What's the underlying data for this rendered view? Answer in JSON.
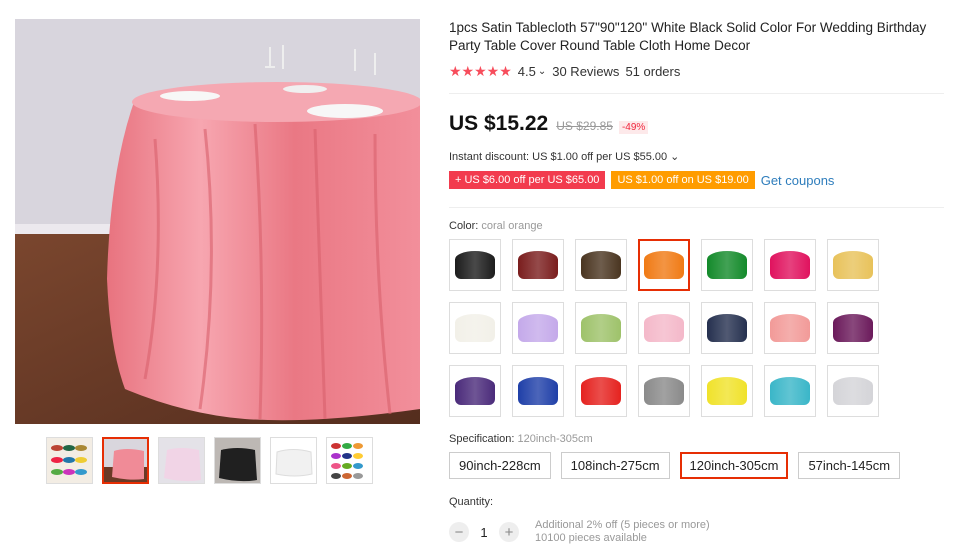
{
  "product": {
    "title": "1pcs Satin Tablecloth 57\"90\"120'' White Black Solid Color For Wedding Birthday Party Table Cover Round Table Cloth Home Decor",
    "stars": "★★★★★",
    "rating": "4.5",
    "rating_chevron": "⌄",
    "reviews": "30 Reviews",
    "orders": "51 orders"
  },
  "price": {
    "current": "US $15.22",
    "original": "US $29.85",
    "discount": "-49%"
  },
  "discount": {
    "instant": "Instant discount: US $1.00 off per US $55.00 ⌄",
    "coupon1": "+ US $6.00 off per US $65.00",
    "coupon2": "US $1.00 off on US $19.00",
    "get_coupons": "Get coupons"
  },
  "color": {
    "label": "Color: ",
    "value": "coral orange",
    "options": [
      "#1c1c1c",
      "#7a1d1d",
      "#4a3520",
      "#f07a14",
      "#138a2a",
      "#e0125e",
      "#e8c25a",
      "#f2f0e8",
      "#c4a9ea",
      "#9ec26a",
      "#f4b8c9",
      "#25304f",
      "#f29a98",
      "#6b1a5b",
      "#4a2a7a",
      "#1f3fa8",
      "#e5221f",
      "#8a8a8a",
      "#f0e22a",
      "#3ab6c8",
      "#d4d4d8"
    ],
    "selected_index": 3
  },
  "spec": {
    "label": "Specification: ",
    "value": "120inch-305cm",
    "options": [
      "90inch-228cm",
      "108inch-275cm",
      "120inch-305cm",
      "57inch-145cm"
    ],
    "selected_index": 2
  },
  "quantity": {
    "label": "Quantity:",
    "value": "1",
    "minus": "−",
    "plus": "+",
    "additional": "Additional 2% off (5 pieces or more)",
    "available": "10100 pieces available"
  },
  "colors": {
    "accent": "#e62e04",
    "star": "#f74d5c",
    "link": "#2e7dbc"
  }
}
